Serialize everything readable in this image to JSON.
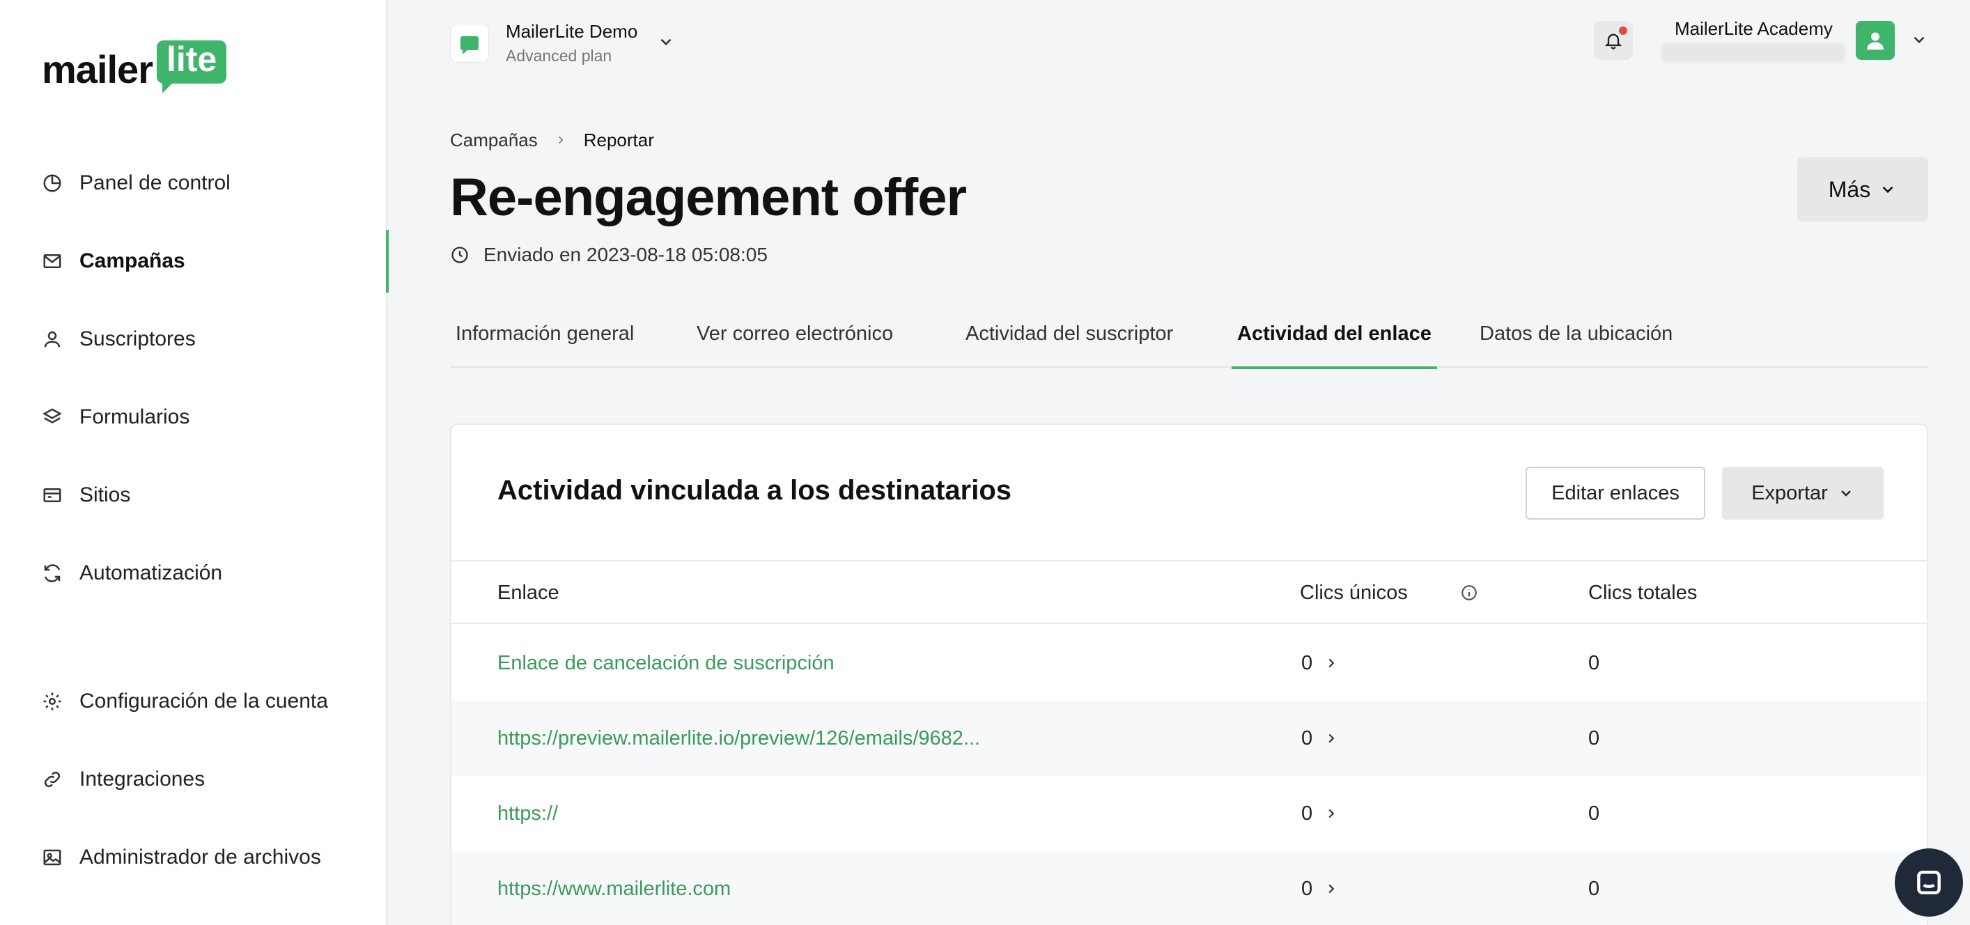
{
  "brand": {
    "logo_text": "mailer",
    "logo_badge": "lite",
    "accent": "#3fb56b"
  },
  "sidebar": {
    "items": [
      {
        "label": "Panel de control",
        "icon": "pie-chart-icon"
      },
      {
        "label": "Campañas",
        "icon": "mail-icon",
        "active": true
      },
      {
        "label": "Suscriptores",
        "icon": "user-icon"
      },
      {
        "label": "Formularios",
        "icon": "layers-icon"
      },
      {
        "label": "Sitios",
        "icon": "browser-icon"
      },
      {
        "label": "Automatización",
        "icon": "refresh-icon"
      },
      {
        "label": "Configuración de la cuenta",
        "icon": "gear-icon"
      },
      {
        "label": "Integraciones",
        "icon": "link-icon"
      },
      {
        "label": "Administrador de archivos",
        "icon": "image-icon"
      }
    ]
  },
  "topbar": {
    "workspace_name": "MailerLite Demo",
    "workspace_plan": "Advanced plan",
    "user_name": "MailerLite Academy"
  },
  "header": {
    "breadcrumb": [
      "Campañas",
      "Reportar"
    ],
    "title": "Re-engagement offer",
    "sent": "Enviado en 2023-08-18 05:08:05",
    "more_button": "Más"
  },
  "tabs": [
    {
      "label": "Información general"
    },
    {
      "label": "Ver correo electrónico"
    },
    {
      "label": "Actividad del suscriptor"
    },
    {
      "label": "Actividad del enlace",
      "active": true
    },
    {
      "label": "Datos de la ubicación"
    }
  ],
  "card": {
    "title": "Actividad vinculada a los destinatarios",
    "edit_button": "Editar enlaces",
    "export_button": "Exportar",
    "columns": [
      "Enlace",
      "Clics únicos",
      "Clics totales"
    ],
    "rows": [
      {
        "link": "Enlace de cancelación de suscripción",
        "unique": "0",
        "total": "0"
      },
      {
        "link": "https://preview.mailerlite.io/preview/126/emails/9682...",
        "unique": "0",
        "total": "0"
      },
      {
        "link": "https://",
        "unique": "0",
        "total": "0"
      },
      {
        "link": "https://www.mailerlite.com",
        "unique": "0",
        "total": "0"
      }
    ]
  }
}
